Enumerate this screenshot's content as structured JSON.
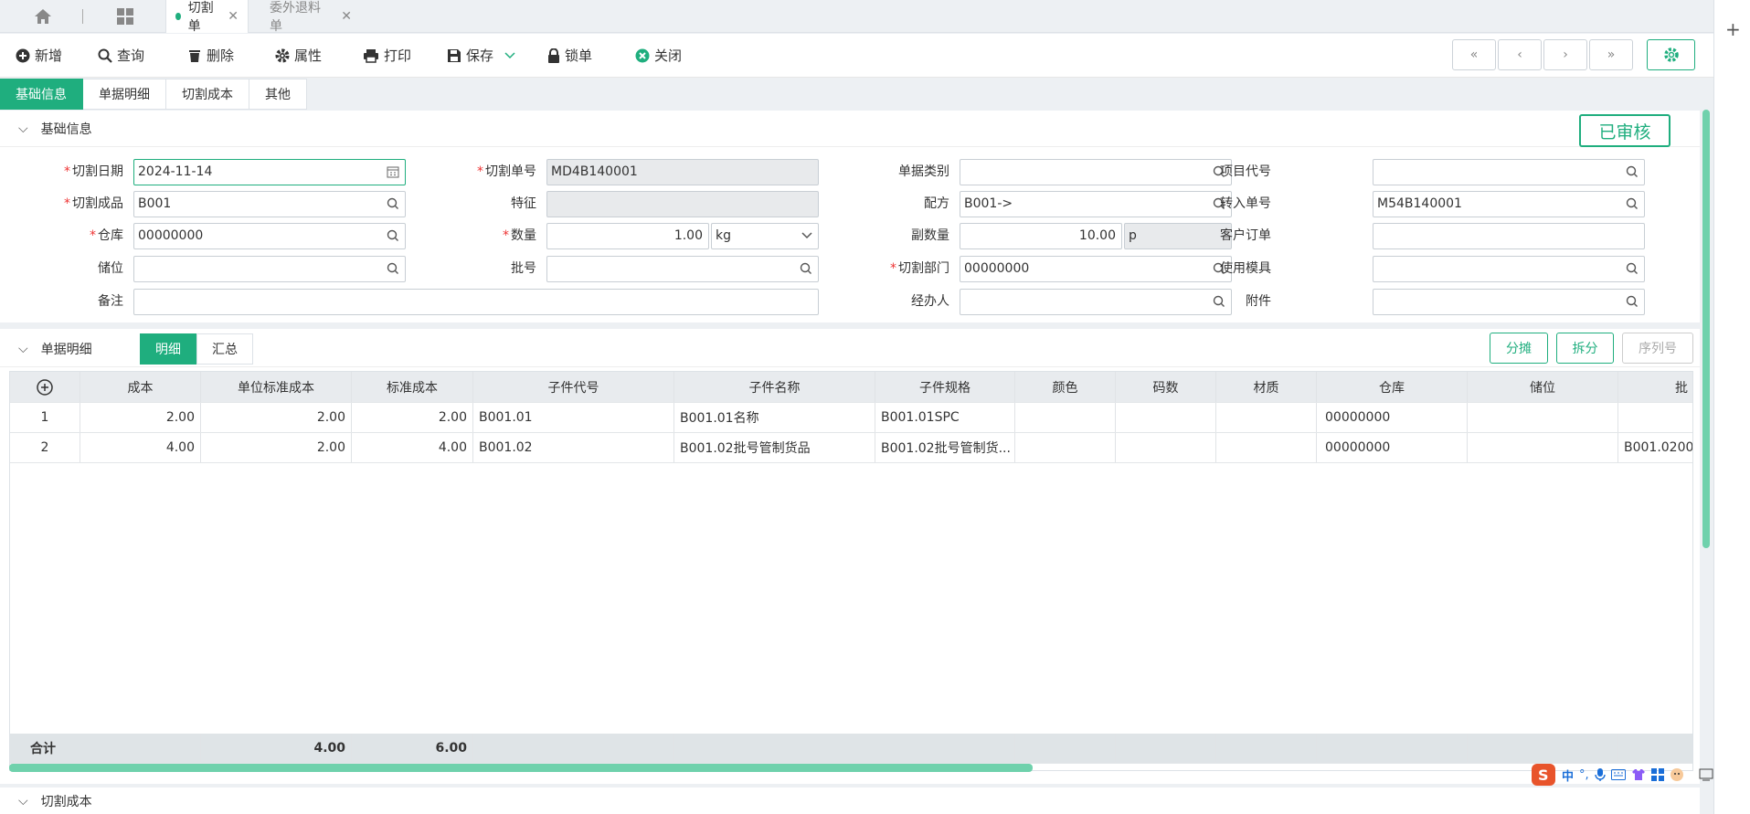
{
  "tabs": {
    "active": "切割单",
    "inactive": "委外退料单"
  },
  "toolbar": {
    "add": "新增",
    "query": "查询",
    "delete": "删除",
    "props": "属性",
    "print": "打印",
    "save": "保存",
    "lock": "锁单",
    "close": "关闭"
  },
  "subtabs": [
    "基础信息",
    "单据明细",
    "切割成本",
    "其他"
  ],
  "basic": {
    "title": "基础信息",
    "status": "已审核",
    "labels": {
      "date": "切割日期",
      "bill_no": "切割单号",
      "bill_type": "单据类别",
      "project": "项目代号",
      "product": "切割成品",
      "feature": "特征",
      "formula": "配方",
      "transfer_no": "转入单号",
      "warehouse": "仓库",
      "qty": "数量",
      "sub_qty": "副数量",
      "cust_order": "客户订单",
      "location": "储位",
      "batch": "批号",
      "dept": "切割部门",
      "mold": "使用模具",
      "remark": "备注",
      "handler": "经办人",
      "attach": "附件"
    },
    "values": {
      "date": "2024-11-14",
      "bill_no": "MD4B140001",
      "bill_type": "",
      "project": "",
      "product": "B001",
      "feature": "",
      "formula": "B001->",
      "transfer_no": "M54B140001",
      "warehouse": "00000000",
      "qty": "1.00",
      "unit": "kg",
      "sub_qty": "10.00",
      "sub_unit": "p",
      "cust_order": "",
      "location": "",
      "batch": "",
      "dept": "00000000",
      "mold": "",
      "remark": "",
      "handler": "",
      "attach": ""
    }
  },
  "detail": {
    "title": "单据明细",
    "seg": [
      "明细",
      "汇总"
    ],
    "buttons": [
      "分摊",
      "拆分",
      "序列号"
    ],
    "columns": [
      "",
      "成本",
      "单位标准成本",
      "标准成本",
      "子件代号",
      "子件名称",
      "子件规格",
      "颜色",
      "码数",
      "材质",
      "仓库",
      "储位",
      "批"
    ],
    "rows": [
      [
        "1",
        "2.00",
        "2.00",
        "2.00",
        "B001.01",
        "B001.01名称",
        "B001.01SPC",
        "",
        "",
        "",
        "00000000",
        "",
        ""
      ],
      [
        "2",
        "4.00",
        "2.00",
        "4.00",
        "B001.02",
        "B001.02批号管制货品",
        "B001.02批号管制货...",
        "",
        "",
        "",
        "00000000",
        "",
        "B001.0200"
      ]
    ],
    "footer": [
      "合计",
      "",
      "4.00",
      "6.00",
      "",
      "",
      "",
      "",
      "",
      "",
      "",
      "",
      ""
    ]
  },
  "cost": {
    "title": "切割成本"
  },
  "tray": {
    "ime": "中"
  }
}
